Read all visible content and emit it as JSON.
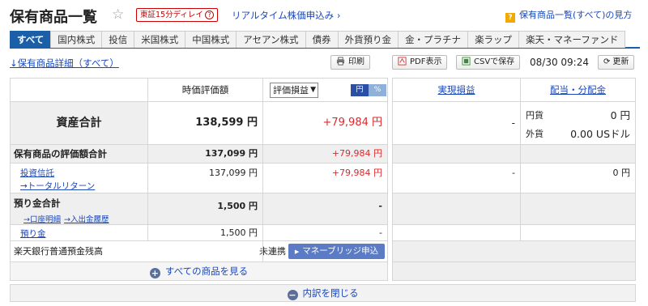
{
  "header": {
    "title": "保有商品一覧",
    "delay_badge": "東証15分ディレイ",
    "delay_q": "?",
    "realtime_link": "リアルタイム株価申込み",
    "help_q": "?",
    "help_link": "保有商品一覧(すべて)の見方"
  },
  "tabs": [
    "すべて",
    "国内株式",
    "投信",
    "米国株式",
    "中国株式",
    "アセアン株式",
    "債券",
    "外貨預り金",
    "金・プラチナ",
    "楽ラップ",
    "楽天・マネーファンド"
  ],
  "toolbar": {
    "detail_link": "↓保有商品詳細（すべて）",
    "print": "印刷",
    "pdf": "PDF表示",
    "csv": "CSVで保存",
    "datetime": "08/30 09:24",
    "refresh": "更新"
  },
  "columns": {
    "market_value": "時価評価額",
    "select_value": "評価損益",
    "toggle_yen": "円",
    "toggle_pct": "%",
    "realized": "実現損益",
    "dividends": "配当・分配金"
  },
  "rows": {
    "total": {
      "label": "資産合計",
      "value": "138,599 円",
      "pl": "+79,984 円",
      "realized": "-",
      "yen_label": "円貨",
      "yen_value": "0 円",
      "fx_label": "外貨",
      "fx_value": "0.00 USドル"
    },
    "holdings": {
      "label": "保有商品の評価額合計",
      "value": "137,099 円",
      "pl": "+79,984 円"
    },
    "fund": {
      "label": "投資信託",
      "sub": "→トータルリターン",
      "value": "137,099 円",
      "pl": "+79,984 円",
      "realized": "-",
      "dividend": "0 円"
    },
    "deposit": {
      "label": "預り金合計",
      "sub1": "→口座明細",
      "sub2": "→入出金履歴",
      "value": "1,500 円",
      "pl": "-"
    },
    "deposit_item": {
      "label": "預り金",
      "value": "1,500 円",
      "pl": "-"
    },
    "bank": {
      "label": "楽天銀行普通預金残高",
      "status": "未連携",
      "button": "マネーブリッジ申込"
    }
  },
  "footer": {
    "show_all": "すべての商品を見る",
    "plus": "+",
    "close": "内訳を閉じる",
    "minus": "−"
  }
}
